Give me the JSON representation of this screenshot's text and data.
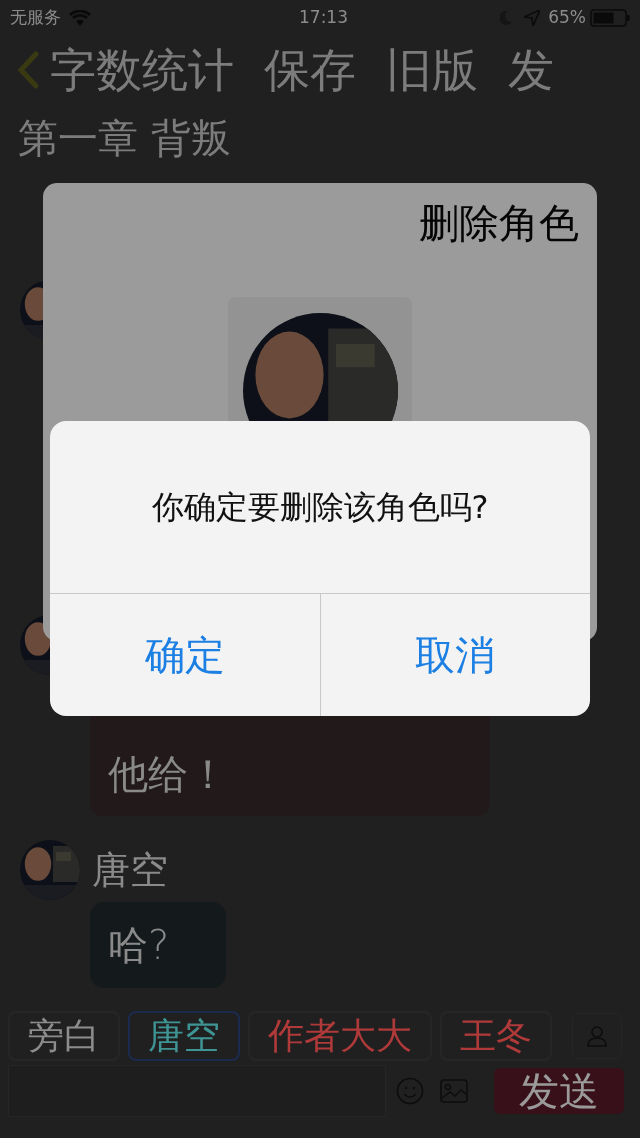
{
  "status_bar": {
    "carrier": "无服务",
    "time": "17:13",
    "battery": "65%"
  },
  "nav": {
    "items": [
      "字数统计",
      "保存",
      "旧版",
      "发"
    ]
  },
  "chapter_title": "第一章 背叛",
  "messages": [
    {
      "kind": "bubble",
      "text": "他给！"
    },
    {
      "kind": "speaker",
      "name": "唐空"
    },
    {
      "kind": "short",
      "text": "哈?"
    }
  ],
  "role_tabs": [
    {
      "label": "旁白",
      "color": "#8c8c8c",
      "selected": false
    },
    {
      "label": "唐空",
      "color": "#3f9494",
      "selected": true
    },
    {
      "label": "作者大大",
      "color": "#b03a3a",
      "selected": false
    },
    {
      "label": "王冬",
      "color": "#b03a3a",
      "selected": false
    }
  ],
  "send_button": "发送",
  "role_dialog": {
    "title": "删除角色"
  },
  "alert": {
    "message": "你确定要删除该角色吗?",
    "buttons": [
      "确定",
      "取消"
    ]
  }
}
